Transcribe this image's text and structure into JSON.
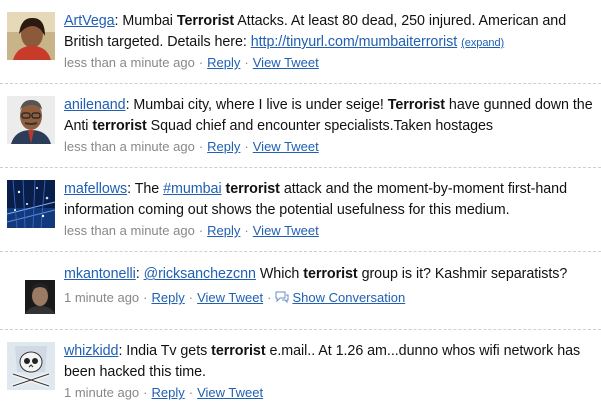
{
  "tweets": [
    {
      "user": "ArtVega",
      "parts": [
        ": Mumbai ",
        "Terrorist",
        " Attacks. At least 80 dead, 250 injured. American and British targeted. Details here: "
      ],
      "link": "http://tinyurl.com/mumbaiterrorist",
      "expand": "(expand)",
      "time": "less than a minute ago",
      "reply": "Reply",
      "view": "View Tweet"
    },
    {
      "user": "anilenand",
      "parts": [
        ": Mumbai city, where I live is under seige! ",
        "Terrorist",
        " have gunned down the Anti ",
        "terrorist",
        " Squad chief and encounter specialists.Taken hostages"
      ],
      "time": "less than a minute ago",
      "reply": "Reply",
      "view": "View Tweet"
    },
    {
      "user": "mafellows",
      "parts": [
        ": The "
      ],
      "hashtag": "#mumbai",
      "parts2": [
        " ",
        "terrorist",
        " attack and the moment-by-moment first-hand information coming out shows the potential usefulness for this medium."
      ],
      "time": "less than a minute ago",
      "reply": "Reply",
      "view": "View Tweet"
    },
    {
      "user": "mkantonelli",
      "parts": [
        ": "
      ],
      "mention": "@ricksanchezcnn",
      "parts2": [
        " Which ",
        "terrorist",
        " group is it? Kashmir separatists?"
      ],
      "time": "1 minute ago",
      "reply": "Reply",
      "view": "View Tweet",
      "conversation": "Show Conversation"
    },
    {
      "user": "whizkidd",
      "parts": [
        ": India Tv gets ",
        "terrorist",
        " e.mail.. At 1.26 am...dunno whos wifi network has been hacked this time."
      ],
      "time": "1 minute ago",
      "reply": "Reply",
      "view": "View Tweet"
    }
  ],
  "separator": "·",
  "colors": {
    "link": "#1f5fb4",
    "meta": "#888888",
    "text": "#111111"
  },
  "avatars": [
    "woman-portrait",
    "man-portrait-glasses",
    "blue-city-lights",
    "man-dark-portrait",
    "skull-crossbones"
  ]
}
